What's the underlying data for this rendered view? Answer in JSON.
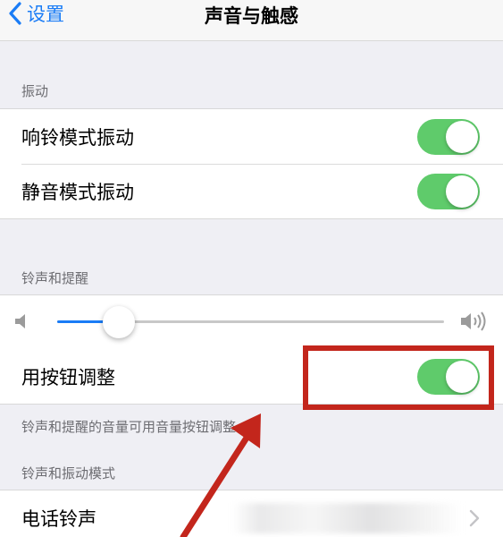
{
  "navbar": {
    "back_label": "设置",
    "title": "声音与触感"
  },
  "vibration": {
    "header": "振动",
    "items": [
      {
        "label": "响铃模式振动",
        "on": true
      },
      {
        "label": "静音模式振动",
        "on": true
      }
    ]
  },
  "ringer": {
    "header": "铃声和提醒",
    "volume_fraction": 0.16,
    "adjust_label": "用按钮调整",
    "adjust_on": true,
    "footnote": "铃声和提醒的音量可用音量按钮调整。"
  },
  "patterns": {
    "header": "铃声和振动模式",
    "ringtone_label": "电话铃声"
  },
  "colors": {
    "toggle_on": "#5fcb6b",
    "accent": "#1a7cf6",
    "annotation_red": "#c3261c"
  },
  "icons": [
    "chevron-left-icon",
    "speaker-low-icon",
    "speaker-high-icon",
    "chevron-right-icon"
  ]
}
